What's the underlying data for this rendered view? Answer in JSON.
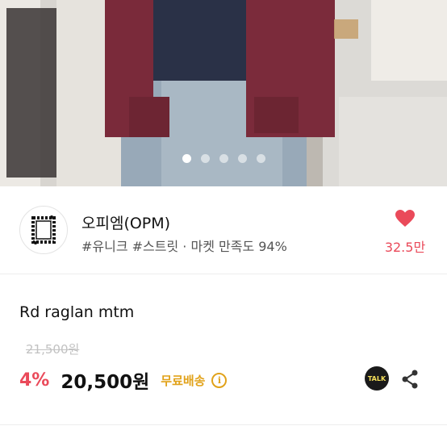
{
  "gallery": {
    "image_alt": "product photo",
    "dots": [
      true,
      false,
      false,
      false,
      false
    ]
  },
  "shop": {
    "name": "오피엠(OPM)",
    "tags": "#유니크 #스트릿 · 마켓 만족도 94%",
    "likes": "32.5만",
    "icons": {
      "logo": "shop-logo-icon",
      "like": "heart-icon"
    }
  },
  "product": {
    "title": "Rd raglan mtm",
    "original_price": "21,500원",
    "discount": "4%",
    "price": "20,500원",
    "shipping": "무료배송",
    "info_glyph": "i",
    "talk_label": "TALK"
  },
  "colors": {
    "accent": "#ea4a5a",
    "shipping": "#e1a21a"
  }
}
